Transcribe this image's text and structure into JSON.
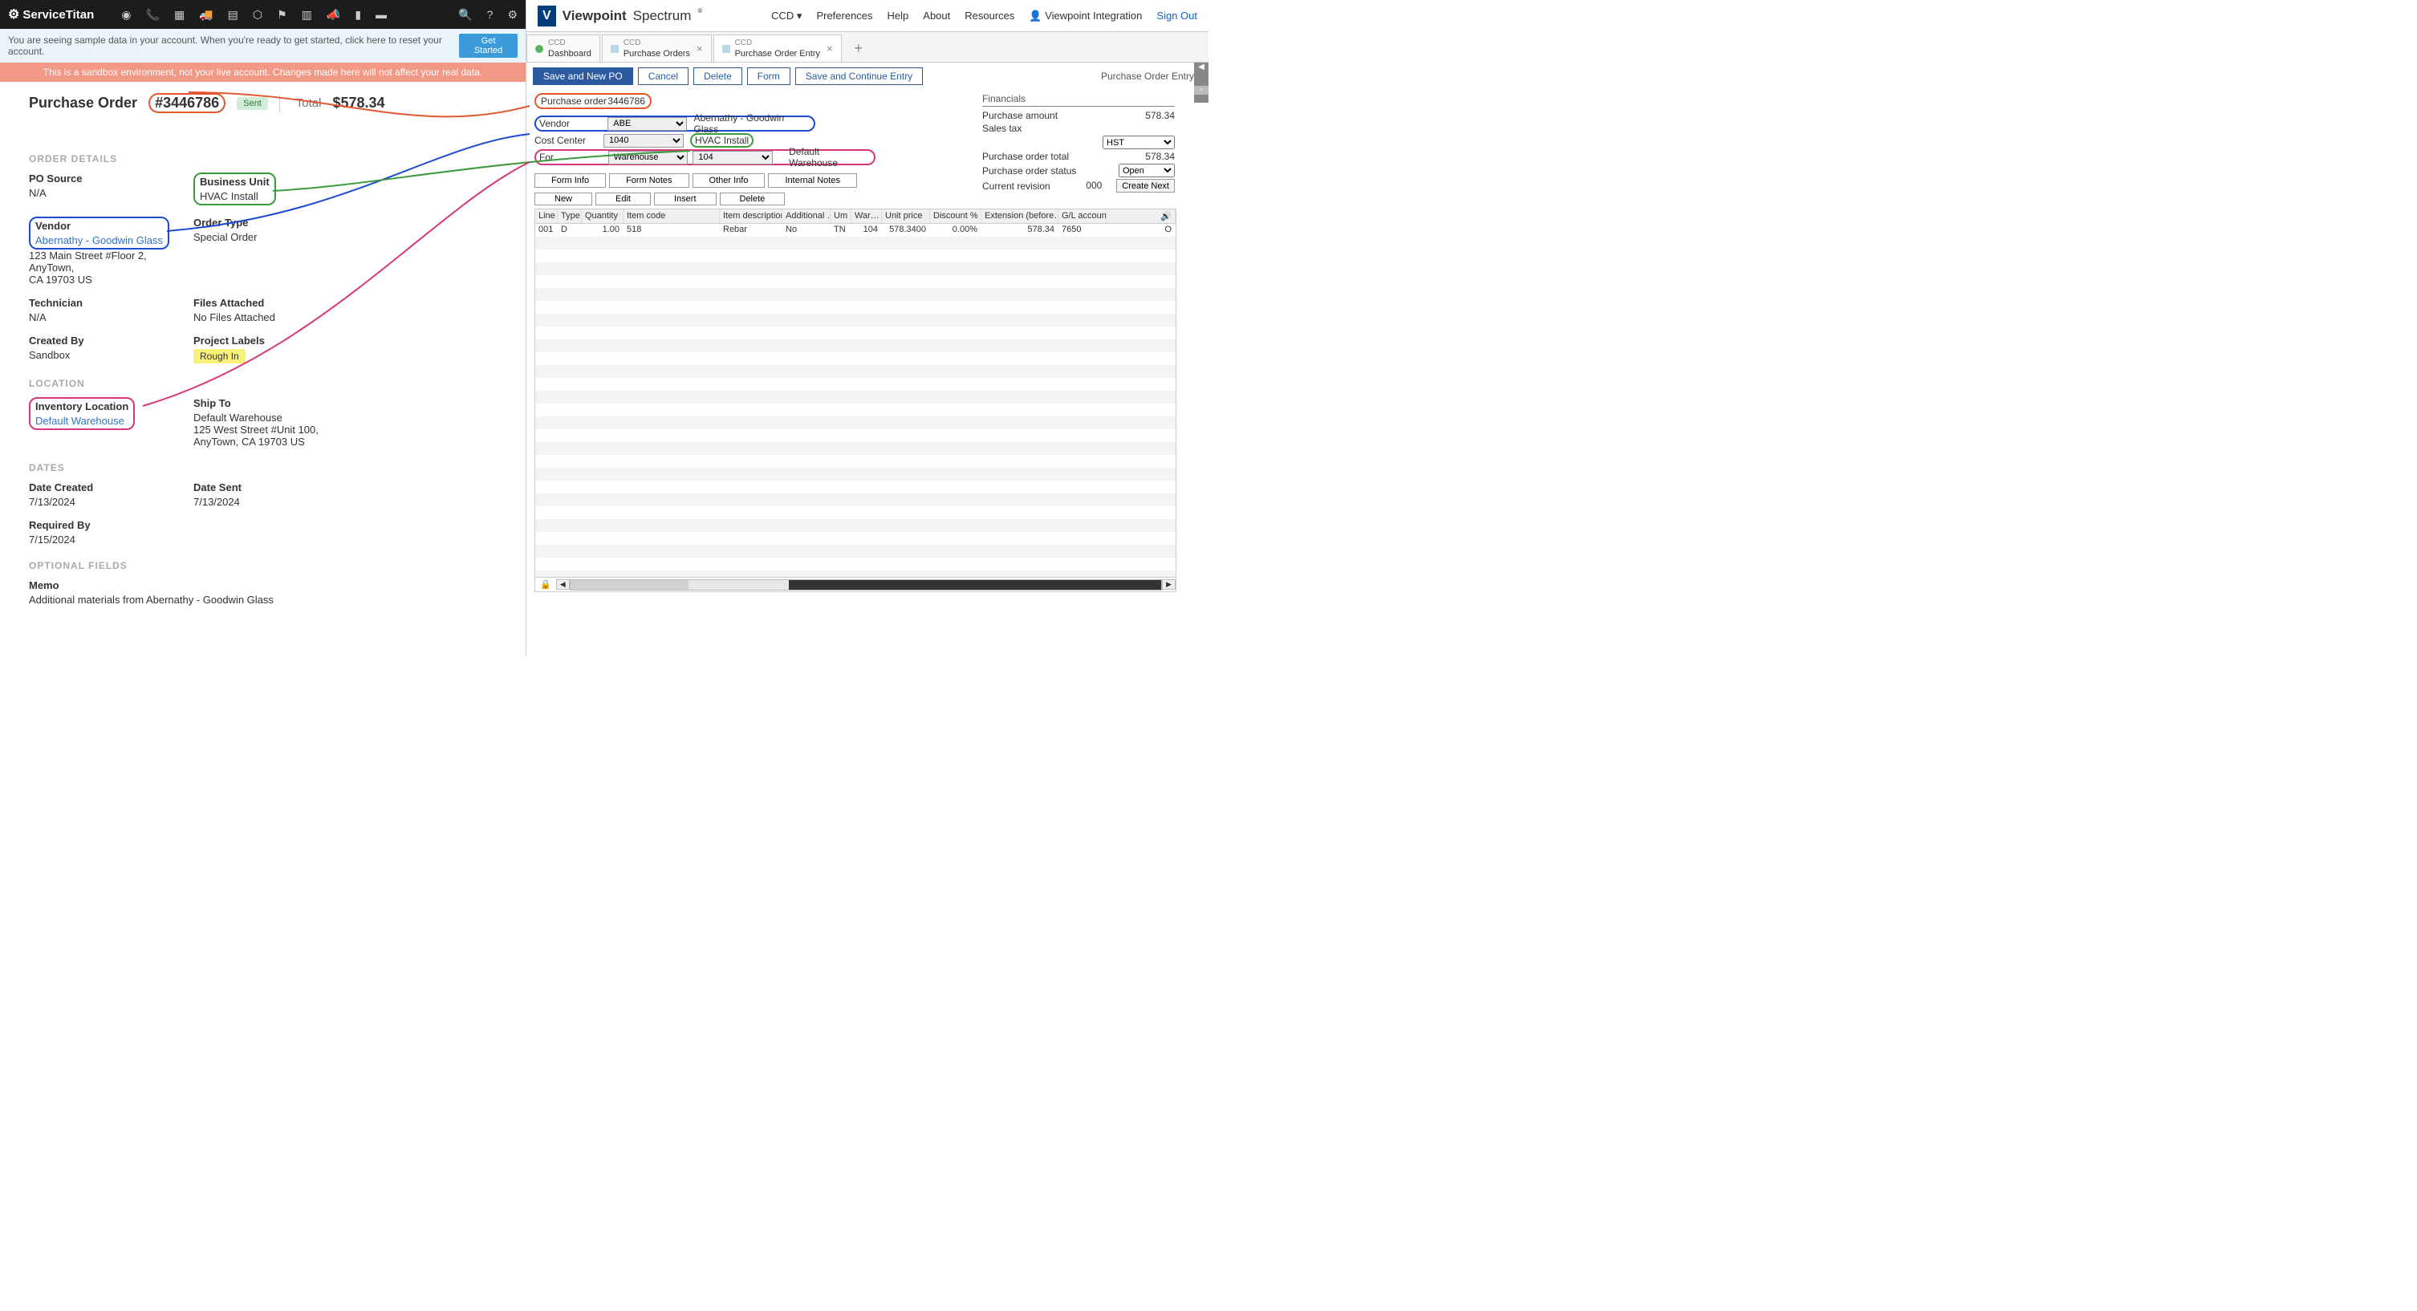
{
  "st": {
    "logo": "ServiceTitan",
    "banner1_text": "You are seeing sample data in your account. When you're ready to get started, click here to reset your account.",
    "banner1_btn": "Get Started",
    "banner2_text": "This is a sandbox environment, not your live account. Changes made here will not affect your real data.",
    "header": {
      "title": "Purchase Order",
      "po_num": "#3446786",
      "status": "Sent",
      "total_lbl": "Total",
      "total_val": "$578.34"
    },
    "sections": {
      "order_details": "ORDER DETAILS",
      "location": "LOCATION",
      "dates": "DATES",
      "optional": "OPTIONAL FIELDS"
    },
    "fields": {
      "po_source_lbl": "PO Source",
      "po_source_val": "N/A",
      "bu_lbl": "Business Unit",
      "bu_val": "HVAC Install",
      "vendor_lbl": "Vendor",
      "vendor_val": "Abernathy - Goodwin Glass",
      "vendor_addr1": "123 Main Street #Floor 2, AnyTown,",
      "vendor_addr2": "CA 19703 US",
      "order_type_lbl": "Order Type",
      "order_type_val": "Special Order",
      "tech_lbl": "Technician",
      "tech_val": "N/A",
      "files_lbl": "Files Attached",
      "files_val": "No Files Attached",
      "created_lbl": "Created By",
      "created_val": "Sandbox",
      "labels_lbl": "Project Labels",
      "labels_val": "Rough In",
      "inv_loc_lbl": "Inventory Location",
      "inv_loc_val": "Default Warehouse",
      "ship_lbl": "Ship To",
      "ship_val1": "Default Warehouse",
      "ship_val2": "125 West Street #Unit 100,",
      "ship_val3": "AnyTown, CA 19703 US",
      "date_created_lbl": "Date Created",
      "date_created_val": "7/13/2024",
      "date_sent_lbl": "Date Sent",
      "date_sent_val": "7/13/2024",
      "required_lbl": "Required By",
      "required_val": "7/15/2024",
      "memo_lbl": "Memo",
      "memo_val": "Additional materials from Abernathy - Goodwin Glass"
    }
  },
  "vp": {
    "logo1": "Viewpoint",
    "logo2": "Spectrum",
    "nav": {
      "ccd": "CCD",
      "prefs": "Preferences",
      "help": "Help",
      "about": "About",
      "resources": "Resources",
      "user": "Viewpoint Integration",
      "signout": "Sign Out"
    },
    "tabs": [
      {
        "sup": "CCD",
        "name": "Dashboard"
      },
      {
        "sup": "CCD",
        "name": "Purchase Orders"
      },
      {
        "sup": "CCD",
        "name": "Purchase Order Entry"
      }
    ],
    "toolbar": {
      "save_new": "Save and New PO",
      "cancel": "Cancel",
      "delete": "Delete",
      "form": "Form",
      "save_cont": "Save and Continue Entry",
      "title": "Purchase Order Entry"
    },
    "form": {
      "po_lbl": "Purchase order",
      "po_val": "3446786",
      "vendor_lbl": "Vendor",
      "vendor_val": "ABE",
      "vendor_desc": "Abernathy - Goodwin Glass",
      "cc_lbl": "Cost Center",
      "cc_val": "1040",
      "cc_desc": "HVAC Install",
      "for_lbl": "For",
      "for_val": "Warehouse",
      "for_val2": "104",
      "for_desc": "Default Warehouse"
    },
    "fin": {
      "header": "Financials",
      "amt_lbl": "Purchase amount",
      "amt_val": "578.34",
      "tax_lbl": "Sales tax",
      "tax_val": "HST",
      "total_lbl": "Purchase order total",
      "total_val": "578.34",
      "status_lbl": "Purchase order status",
      "status_val": "Open",
      "rev_lbl": "Current revision",
      "rev_val": "000",
      "create_next": "Create Next"
    },
    "tab_btns": [
      "Form Info",
      "Form Notes",
      "Other Info",
      "Internal Notes"
    ],
    "grid_btns": [
      "New",
      "Edit",
      "Insert",
      "Delete"
    ],
    "grid_cols": [
      "Line",
      "Type",
      "Quantity",
      "Item code",
      "Item description",
      "Additional …",
      "Um",
      "War…",
      "Unit price",
      "Discount %",
      "Extension (before…",
      "G/L account"
    ],
    "grid_row": {
      "line": "001",
      "type": "D",
      "qty": "1.00",
      "code": "518",
      "desc": "Rebar",
      "addl": "No",
      "um": "TN",
      "war": "104",
      "price": "578.3400",
      "disc": "0.00%",
      "ext": "578.34",
      "gl": "7650",
      "tail": "O"
    }
  }
}
